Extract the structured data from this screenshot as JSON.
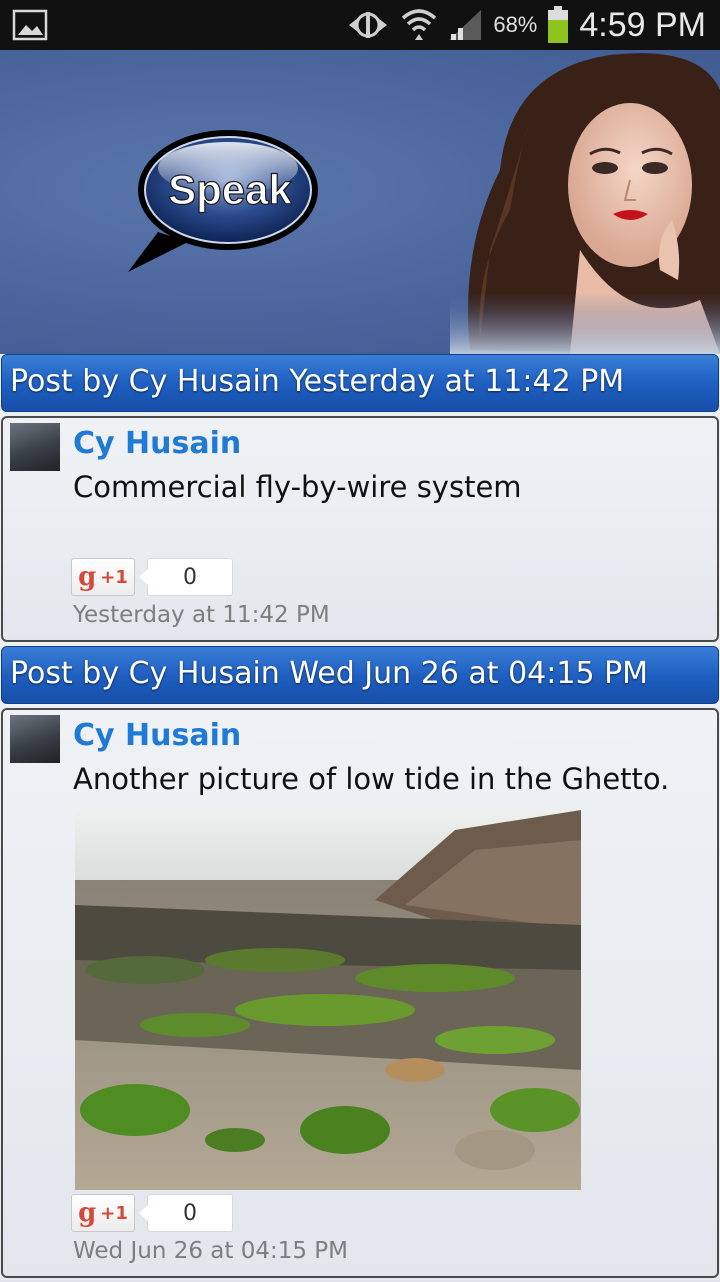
{
  "status_bar": {
    "battery_percent": "68%",
    "time": "4:59 PM",
    "icons": [
      "gallery-icon",
      "sync-icon",
      "wifi-icon",
      "signal-icon",
      "battery-icon"
    ]
  },
  "header": {
    "logo_text": "Speak"
  },
  "posts": [
    {
      "title": "Post by Cy Husain Yesterday at 11:42 PM",
      "author": "Cy Husain",
      "message": "Commercial fly-by-wire system",
      "plus_one_label": "+1",
      "plus_one_count": "0",
      "timestamp": "Yesterday at 11:42 PM"
    },
    {
      "title": "Post by Cy Husain Wed Jun 26 at 04:15 PM",
      "author": "Cy Husain",
      "message": "Another picture of low tide in the Ghetto.",
      "plus_one_label": "+1",
      "plus_one_count": "0",
      "timestamp": "Wed Jun 26 at 04:15 PM"
    }
  ],
  "colors": {
    "header_blue": "#4a659b",
    "post_header_blue": "#1f5fc1",
    "author_blue": "#1f7ad6",
    "plus_red": "#d64937"
  }
}
